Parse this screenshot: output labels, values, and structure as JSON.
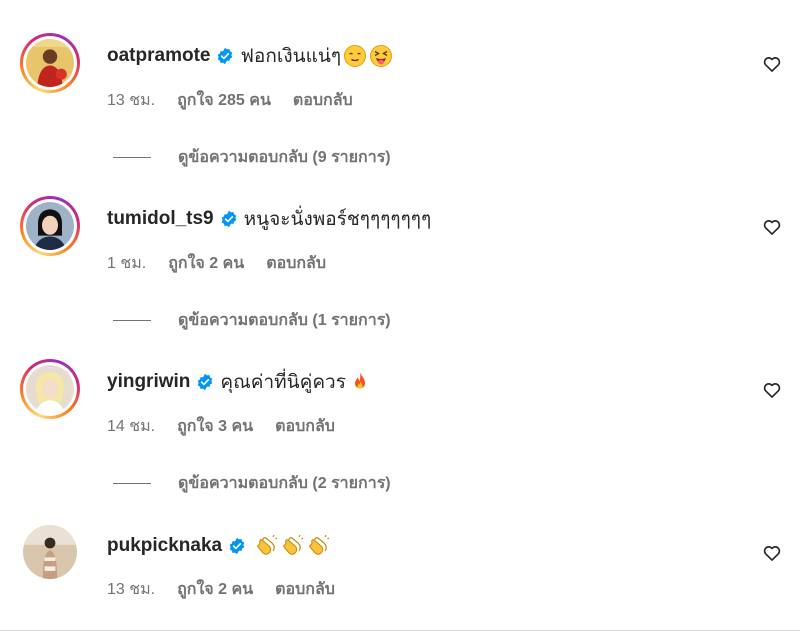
{
  "colors": {
    "text": "#262626",
    "muted": "#737373",
    "verified": "#0095f6"
  },
  "comments": [
    {
      "username": "oatpramote",
      "verified": true,
      "text": "ฟอกเงินแน่ๆ",
      "emojis": [
        "relieved-face-icon",
        "squinting-tongue-face-icon"
      ],
      "time": "13 ชม.",
      "likes": "ถูกใจ 285 คน",
      "reply_label": "ตอบกลับ",
      "view_replies": "ดูข้อความตอบกลับ (9 รายการ)",
      "has_story_ring": true
    },
    {
      "username": "tumidol_ts9",
      "verified": true,
      "text": "หนูจะนั่งพอร์ชๆๆๆๆๆๆๆ",
      "emojis": [],
      "time": "1 ชม.",
      "likes": "ถูกใจ 2 คน",
      "reply_label": "ตอบกลับ",
      "view_replies": "ดูข้อความตอบกลับ (1 รายการ)",
      "has_story_ring": true
    },
    {
      "username": "yingriwin",
      "verified": true,
      "text": "คุณค่าที่นิคู่ควร",
      "emojis": [
        "fire-icon"
      ],
      "time": "14 ชม.",
      "likes": "ถูกใจ 3 คน",
      "reply_label": "ตอบกลับ",
      "view_replies": "ดูข้อความตอบกลับ (2 รายการ)",
      "has_story_ring": true
    },
    {
      "username": "pukpicknaka",
      "verified": true,
      "text": "",
      "emojis": [
        "clapping-hands-icon",
        "clapping-hands-icon",
        "clapping-hands-icon"
      ],
      "time": "13 ชม.",
      "likes": "ถูกใจ 2 คน",
      "reply_label": "ตอบกลับ",
      "view_replies": "",
      "has_story_ring": false
    }
  ]
}
